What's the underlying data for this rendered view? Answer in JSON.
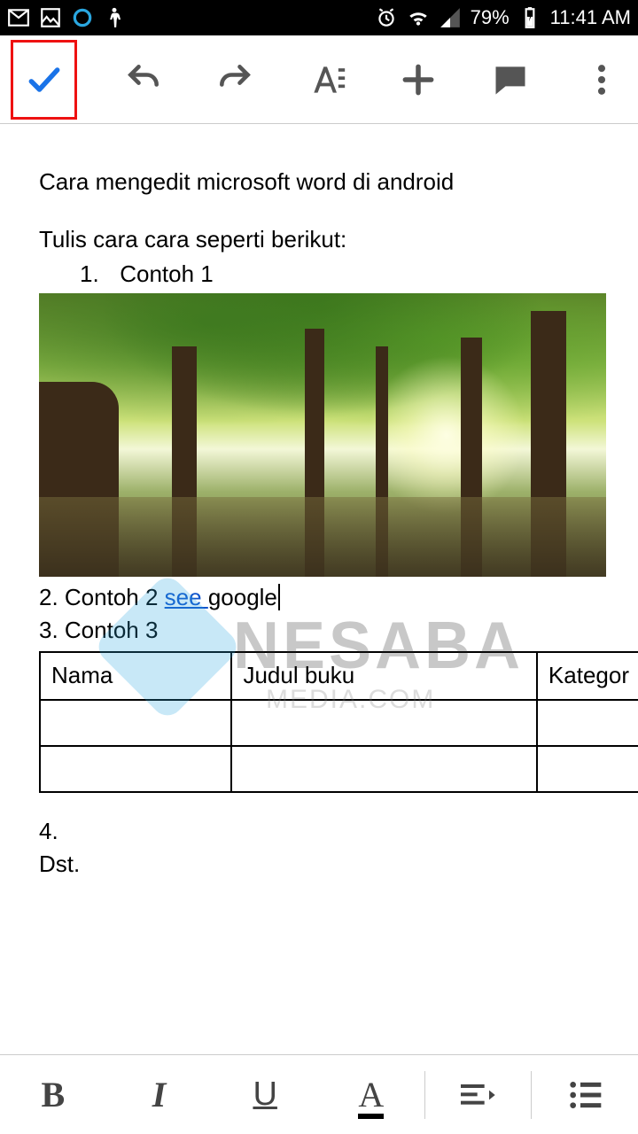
{
  "statusbar": {
    "battery_pct": "79%",
    "time": "11:41 AM"
  },
  "toolbar": {
    "accept_icon": "check",
    "undo_icon": "undo",
    "redo_icon": "redo",
    "textformat_icon": "text-format",
    "insert_icon": "plus",
    "comment_icon": "comment",
    "overflow_icon": "more-vert"
  },
  "document": {
    "title_line": "Cara mengedit microsoft word di android",
    "intro_line": "Tulis cara cara seperti berikut:",
    "item1_num": "1.",
    "item1_text": "Contoh 1",
    "item2_prefix": "2. Contoh 2 ",
    "item2_link_text": "see ",
    "item2_after_link": "google",
    "item3": "3. Contoh 3",
    "table": {
      "headers": [
        "Nama",
        "Judul buku",
        "Kategor"
      ],
      "rows": [
        [
          "",
          "",
          ""
        ],
        [
          "",
          "",
          ""
        ]
      ]
    },
    "item4": "4.",
    "dst": "Dst.",
    "watermark_text": "NESABA",
    "watermark_sub": "MEDIA.COM"
  },
  "formatbar": {
    "bold": "B",
    "italic": "I",
    "underline": "U",
    "textcolor": "A"
  }
}
